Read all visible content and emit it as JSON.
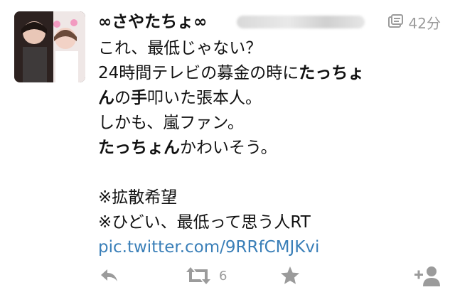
{
  "tweet": {
    "display_name": "∞さやたちょ∞",
    "timestamp": "42分",
    "text": {
      "line1": "これ、最低じゃない？",
      "line2a": "24時間テレビの募金の時に",
      "line2b": "たっちょ",
      "line3a": "ん",
      "line3b": "の",
      "line3c": "手",
      "line3d": "叩いた張本人。",
      "line4": "しかも、嵐ファン。",
      "line5a": "たっちょん",
      "line5b": "かわいそう。",
      "line6": "※拡散希望",
      "line7": "※ひどい、最低って思う人RT",
      "link": "pic.twitter.com/9RRfCMJKvi"
    },
    "retweet_count": "6"
  },
  "icons": {
    "reply": "reply-icon",
    "retweet": "retweet-icon",
    "favorite": "star-icon",
    "follow": "add-user-icon",
    "media": "media-indicator-icon"
  },
  "colors": {
    "link": "#3a7fb8",
    "muted": "#9b9b9b",
    "text": "#111111"
  }
}
